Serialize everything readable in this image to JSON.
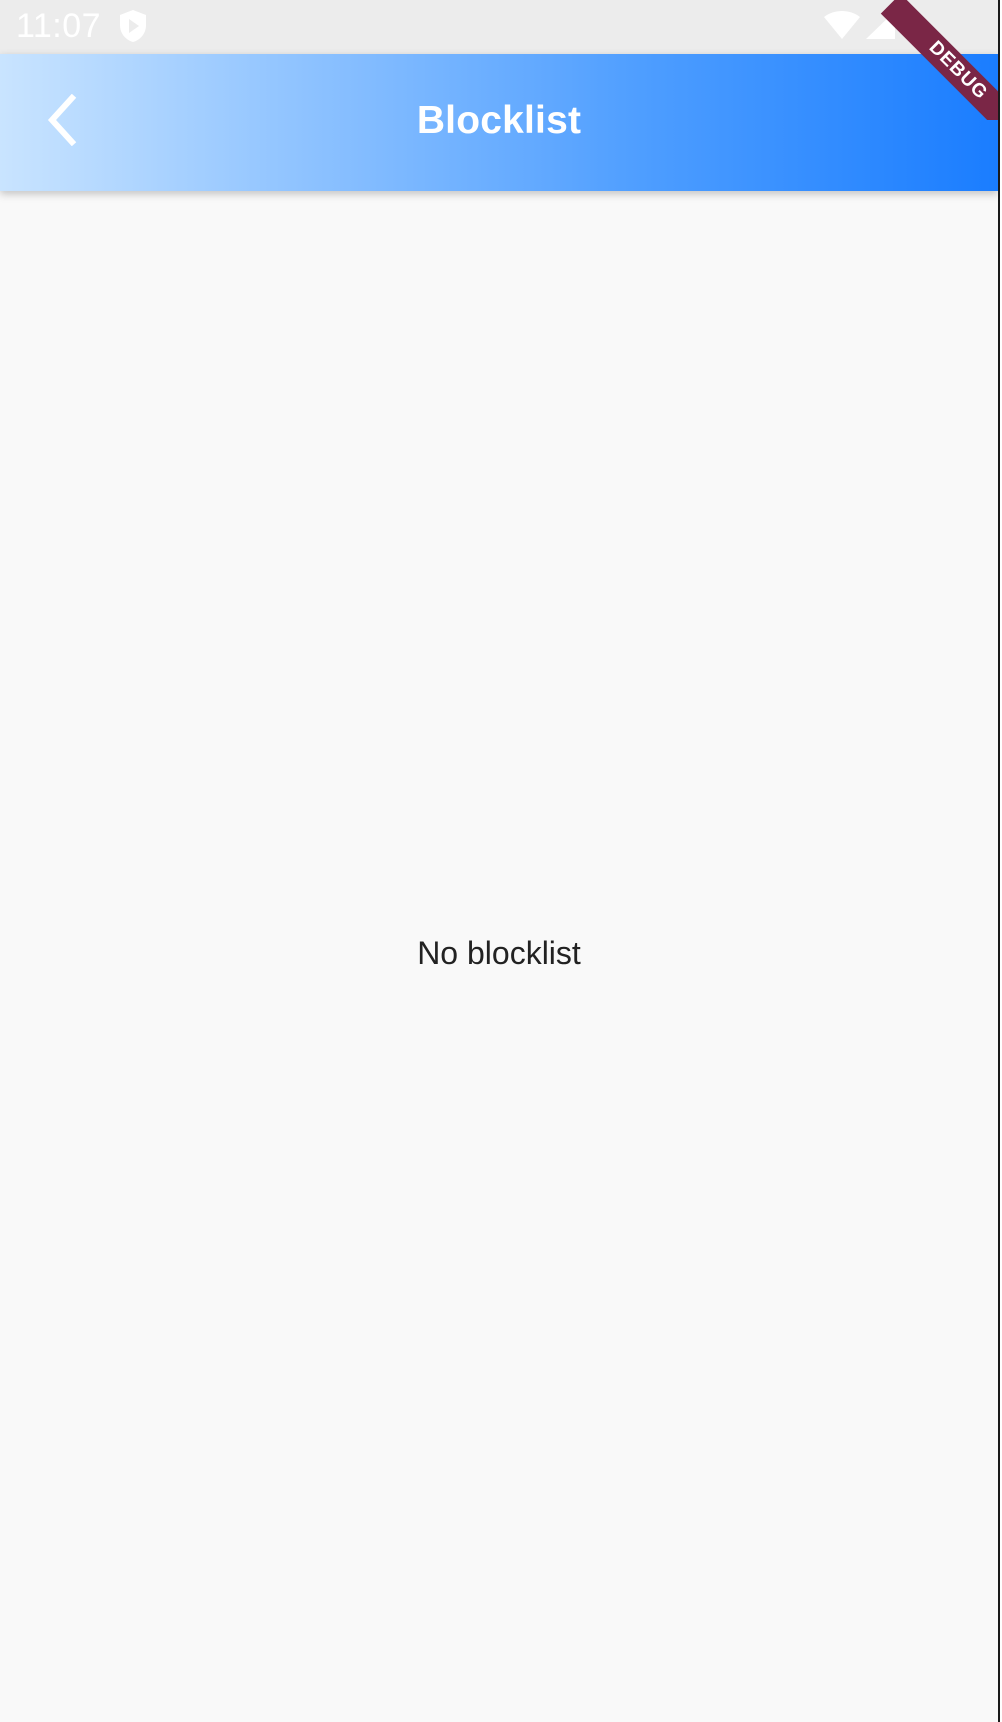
{
  "status_bar": {
    "time": "11:07",
    "icons": [
      "shield-play-icon",
      "wifi-icon",
      "cell-signal-icon"
    ]
  },
  "app_bar": {
    "title": "Blocklist",
    "back_icon": "chevron-left-icon",
    "gradient_colors": [
      "#c9e4ff",
      "#8fc3ff",
      "#4d9dff",
      "#1a7dff"
    ]
  },
  "debug_banner": {
    "label": "DEBUG",
    "color": "#7a2646"
  },
  "content": {
    "empty_message": "No blocklist",
    "background": "#f9f9f9"
  }
}
